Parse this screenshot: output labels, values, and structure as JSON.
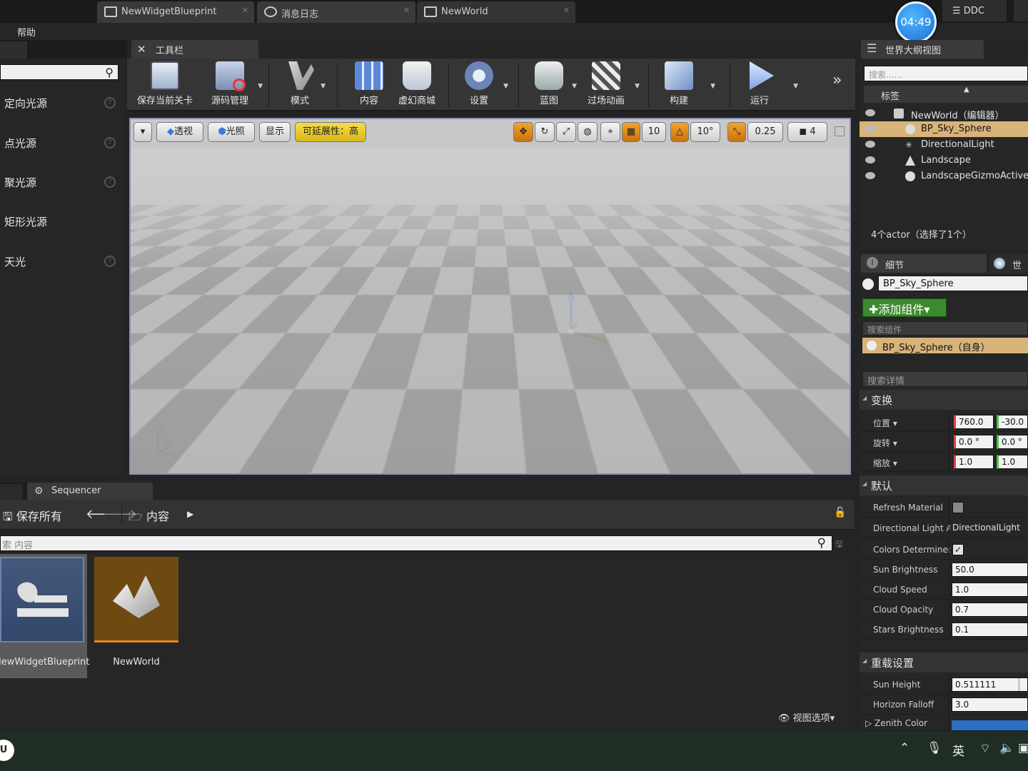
{
  "tabs": [
    {
      "label": "NewWidgetBlueprint"
    },
    {
      "label": "消息日志"
    },
    {
      "label": "NewWorld"
    }
  ],
  "timer": "04:49",
  "ddc": "DDC",
  "menu": {
    "help": "帮助"
  },
  "left_panel": {
    "items": [
      {
        "label": "定向光源"
      },
      {
        "label": "点光源"
      },
      {
        "label": "聚光源"
      },
      {
        "label": "矩形光源"
      },
      {
        "label": "天光"
      }
    ]
  },
  "toolbar": {
    "tab_label": "工具栏",
    "buttons": [
      {
        "label": "保存当前关卡",
        "icon": "save-icon"
      },
      {
        "label": "源码管理",
        "icon": "source-control-icon"
      },
      {
        "label": "模式",
        "icon": "modes-icon"
      },
      {
        "label": "内容",
        "icon": "content-icon"
      },
      {
        "label": "虚幻商城",
        "icon": "marketplace-icon"
      },
      {
        "label": "设置",
        "icon": "settings-icon"
      },
      {
        "label": "蓝图",
        "icon": "blueprint-icon"
      },
      {
        "label": "过场动画",
        "icon": "cinematics-icon"
      },
      {
        "label": "构建",
        "icon": "build-icon"
      },
      {
        "label": "运行",
        "icon": "play-icon"
      }
    ]
  },
  "viewport": {
    "perspective": "透视",
    "lit": "光照",
    "show": "显示",
    "scalability": "可延展性：高",
    "grid_snap": "10",
    "rotation_snap": "10°",
    "scale_snap": "0.25",
    "camera_speed": "4",
    "axis_z": "Z",
    "axis_x": "X",
    "axis_y": "Y"
  },
  "outliner": {
    "tab_label": "世界大纲视图",
    "search_placeholder": "搜索......",
    "header": "标签",
    "rows": [
      {
        "label": "NewWorld（编辑器）"
      },
      {
        "label": "BP_Sky_Sphere"
      },
      {
        "label": "DirectionalLight"
      },
      {
        "label": "Landscape"
      },
      {
        "label": "LandscapeGizmoActive"
      }
    ],
    "count": "4个actor（选择了1个）"
  },
  "details": {
    "tab_label": "细节",
    "world_tab_label": "世界",
    "actor_name": "BP_Sky_Sphere",
    "add_component": "✚添加组件▾",
    "component_search": "搜索组件",
    "component_self": "BP_Sky_Sphere（自身）",
    "detail_search": "搜索详情",
    "sections": {
      "transform": "变换",
      "default": "默认",
      "override": "重载设置"
    },
    "transform": {
      "location_label": "位置 ▾",
      "rotation_label": "旋转 ▾",
      "scale_label": "缩放 ▾",
      "location": [
        "760.0",
        "-30.0"
      ],
      "rotation": [
        "0.0 °",
        "0.0 °"
      ],
      "scale": [
        "1.0",
        "1.0"
      ]
    },
    "props": [
      {
        "label": "Refresh Material",
        "value": ""
      },
      {
        "label": "Directional Light A",
        "value": "DirectionalLight"
      },
      {
        "label": "Colors Determined",
        "value": "✓"
      },
      {
        "label": "Sun Brightness",
        "value": "50.0"
      },
      {
        "label": "Cloud Speed",
        "value": "1.0"
      },
      {
        "label": "Cloud Opacity",
        "value": "0.7"
      },
      {
        "label": "Stars Brightness",
        "value": "0.1"
      }
    ],
    "override_props": [
      {
        "label": "Sun Height",
        "value": "0.511111"
      },
      {
        "label": "Horizon Falloff",
        "value": "3.0"
      },
      {
        "label": "Zenith Color",
        "value": ""
      }
    ]
  },
  "sequencer": {
    "tab_label": "Sequencer"
  },
  "content_browser": {
    "save_all": "保存所有",
    "path": "内容",
    "search_placeholder": "索 内容",
    "assets": [
      {
        "label": "NewWidgetBlueprint"
      },
      {
        "label": "NewWorld"
      }
    ],
    "view_options": "视图选项▾"
  },
  "taskbar": {
    "ime": "英"
  },
  "colors": {
    "selection": "#d8b37a",
    "accent_orange": "#e08a1e",
    "add_green": "#3c8a2e",
    "zenith_blue": "#2b6fc4"
  }
}
